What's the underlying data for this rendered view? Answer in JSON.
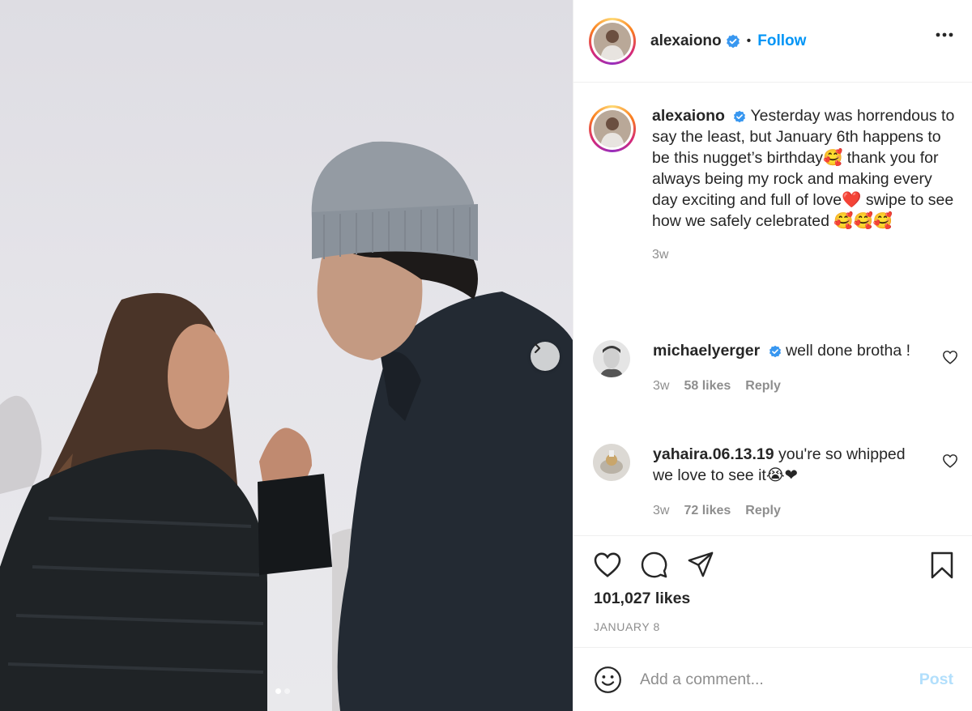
{
  "post": {
    "author": "alexaiono",
    "follow_label": "Follow",
    "separator": "•",
    "caption_username": "alexaiono",
    "caption": "Yesterday was horrendous to say the least, but January 6th happens to be this nugget’s birthday🥰 thank you for always being my rock and making every day exciting and full of love❤️ swipe to see how we safely celebrated 🥰🥰🥰",
    "caption_time": "3w",
    "likes": "101,027 likes",
    "date": "JANUARY 8",
    "carousel": {
      "current": 1,
      "total": 2
    }
  },
  "comments": [
    {
      "username": "michaelyerger",
      "verified": true,
      "text": "well done brotha !",
      "time": "3w",
      "likes": "58 likes",
      "reply_label": "Reply"
    },
    {
      "username": "yahaira.06.13.19",
      "verified": false,
      "text": "you're so whipped we love to see it😭❤",
      "time": "3w",
      "likes": "72 likes",
      "reply_label": "Reply"
    }
  ],
  "composer": {
    "placeholder": "Add a comment...",
    "post_label": "Post"
  },
  "icons": {
    "header": [
      "verified-badge-icon",
      "more-options-icon"
    ],
    "actions": [
      "heart-icon",
      "comment-icon",
      "share-icon",
      "bookmark-icon"
    ],
    "composer": "emoji-icon",
    "carousel": "chevron-right-icon"
  },
  "colors": {
    "link": "#0095f6",
    "post_disabled": "#b2dffc",
    "muted": "#8e8e8e",
    "verified": "#3897f0"
  }
}
